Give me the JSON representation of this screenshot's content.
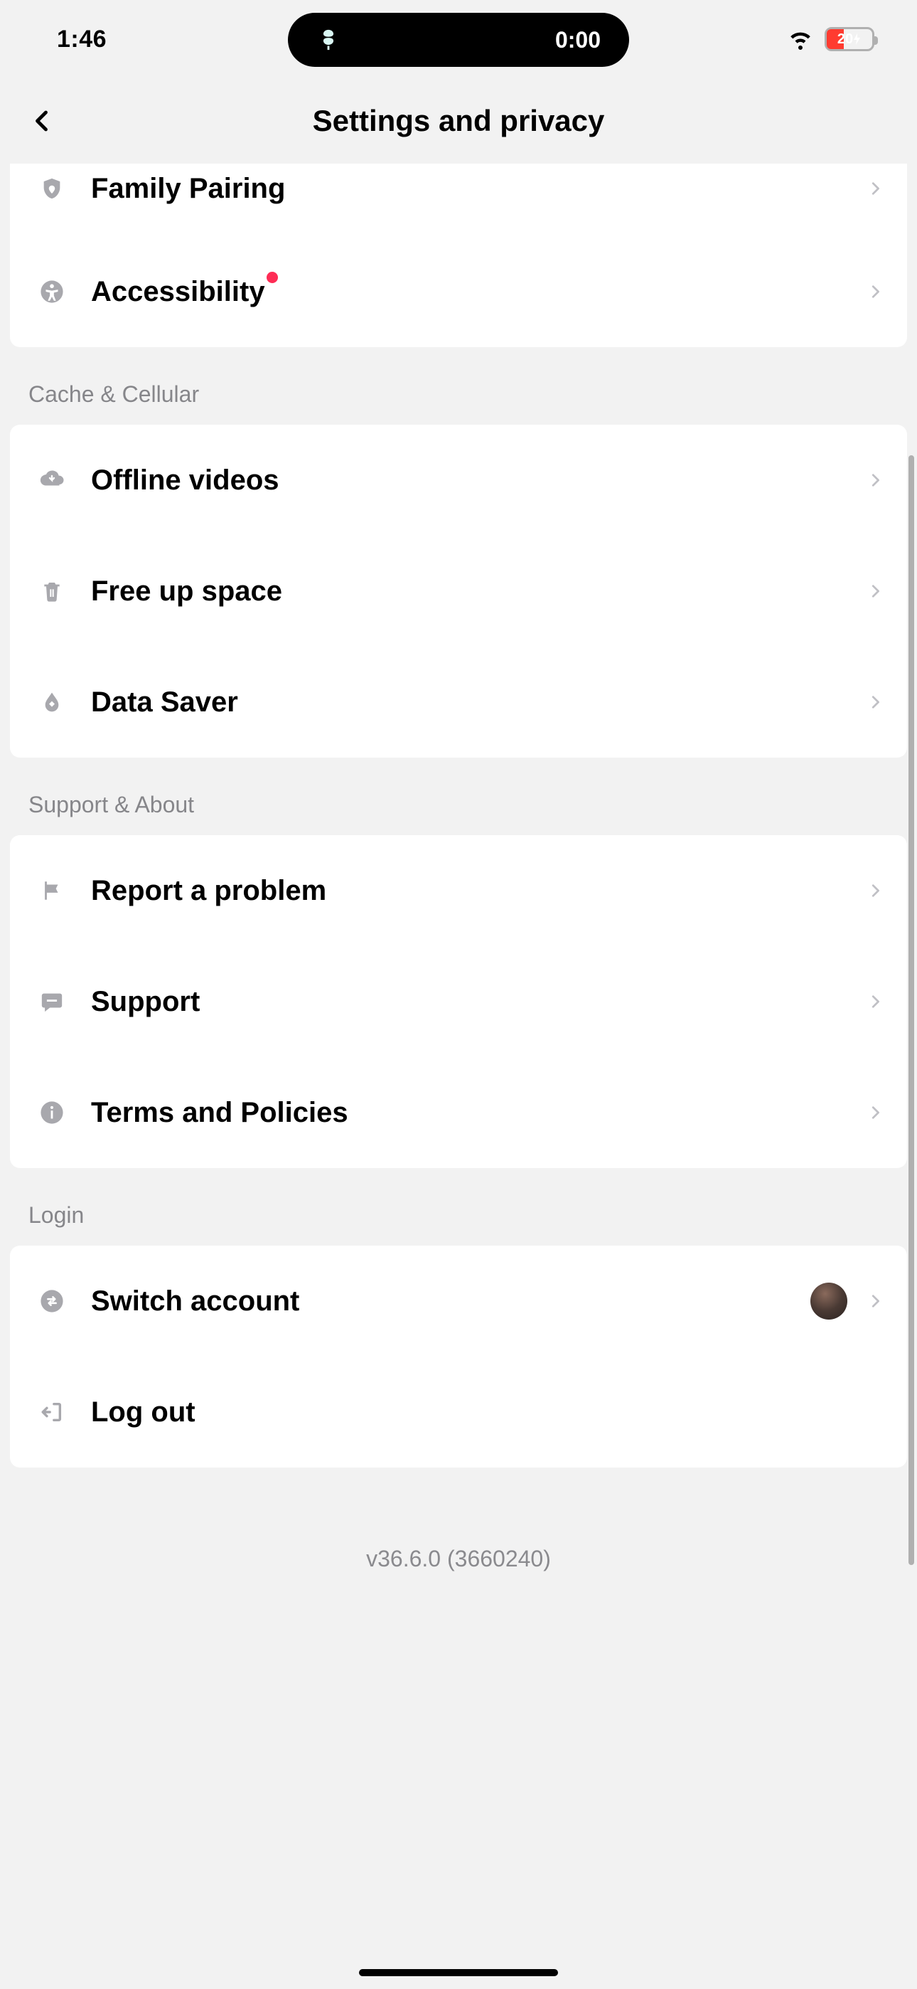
{
  "status": {
    "time": "1:46",
    "island_timer": "0:00",
    "battery_percent": "20"
  },
  "header": {
    "title": "Settings and privacy"
  },
  "group0": {
    "family_pairing": "Family Pairing",
    "accessibility": "Accessibility"
  },
  "sections": {
    "cache": {
      "title": "Cache & Cellular",
      "offline_videos": "Offline videos",
      "free_up_space": "Free up space",
      "data_saver": "Data Saver"
    },
    "support": {
      "title": "Support & About",
      "report_problem": "Report a problem",
      "support": "Support",
      "terms": "Terms and Policies"
    },
    "login": {
      "title": "Login",
      "switch_account": "Switch account",
      "log_out": "Log out"
    }
  },
  "footer": {
    "version": "v36.6.0 (3660240)"
  }
}
